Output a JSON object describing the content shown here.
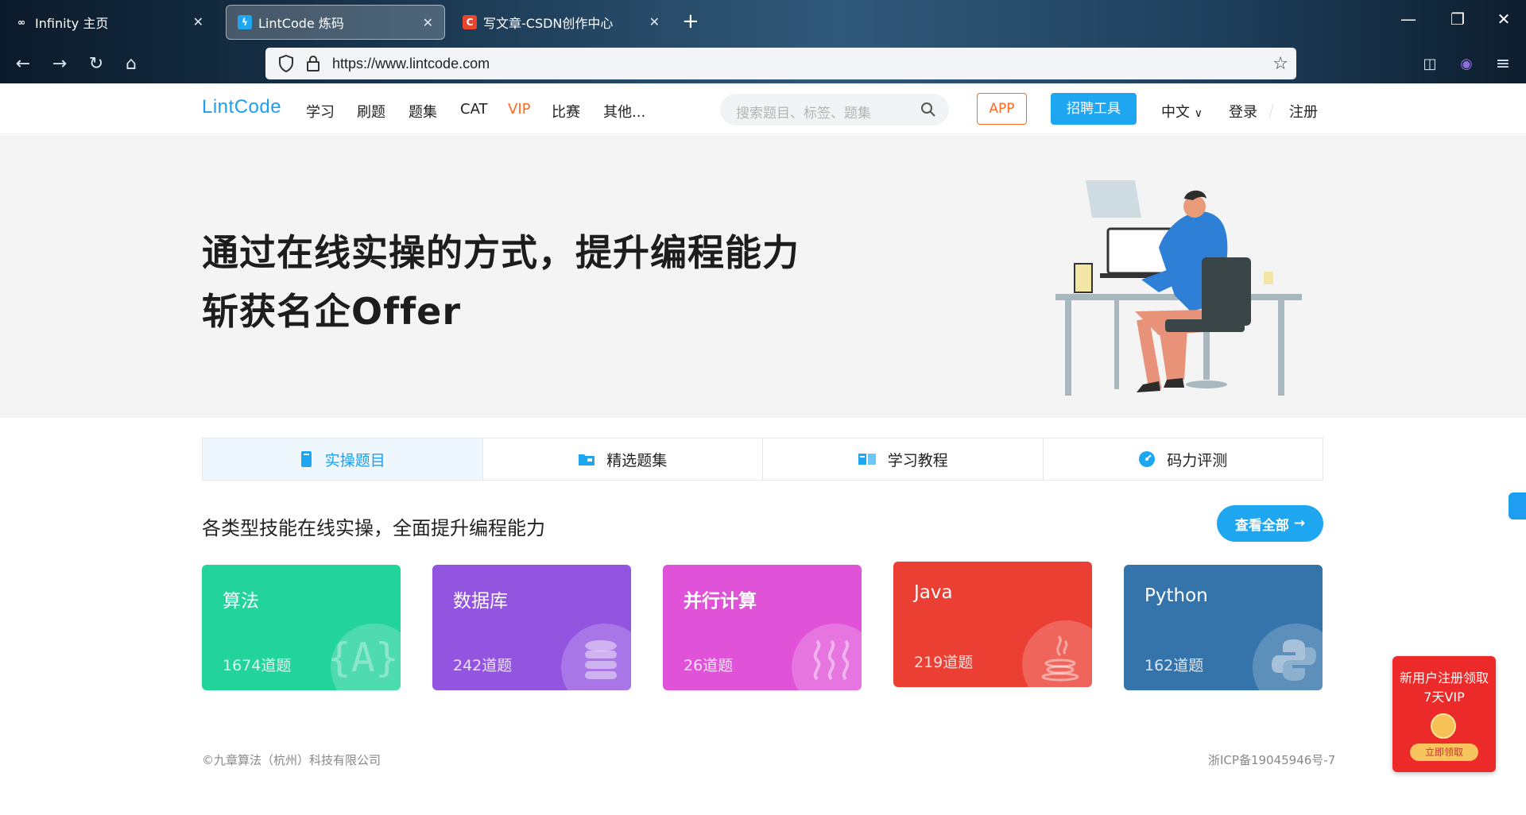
{
  "browser": {
    "tabs": [
      {
        "title": "Infinity 主页",
        "icon": "infinity-icon"
      },
      {
        "title": "LintCode 炼码",
        "icon": "lintcode-icon"
      },
      {
        "title": "写文章-CSDN创作中心",
        "icon": "csdn-icon"
      }
    ],
    "new_tab": "+",
    "url": "https://www.lintcode.com"
  },
  "header": {
    "logo": "LintCode",
    "nav": [
      "学习",
      "刷题",
      "题集",
      "CAT",
      "VIP",
      "比赛",
      "其他..."
    ],
    "search_placeholder": "搜索题目、标签、题集",
    "app_label": "APP",
    "hire_label": "招聘工具",
    "lang_label": "中文",
    "login_label": "登录",
    "register_label": "注册"
  },
  "hero": {
    "line1": "通过在线实操的方式，提升编程能力",
    "line2": "斩获名企Offer"
  },
  "tabs": [
    {
      "label": "实操题目",
      "active": true,
      "icon": "book-icon"
    },
    {
      "label": "精选题集",
      "active": false,
      "icon": "folder-icon"
    },
    {
      "label": "学习教程",
      "active": false,
      "icon": "open-book-icon"
    },
    {
      "label": "码力评测",
      "active": false,
      "icon": "gauge-icon"
    }
  ],
  "section": {
    "title": "各类型技能在线实操，全面提升编程能力",
    "view_all": "查看全部"
  },
  "cards": [
    {
      "title": "算法",
      "count": "1674道题",
      "color": "#22d39a",
      "icon": "algorithm-icon"
    },
    {
      "title": "数据库",
      "count": "242道题",
      "color": "#9354e0",
      "icon": "database-icon"
    },
    {
      "title": "并行计算",
      "count": "26道题",
      "color": "#e053d8",
      "icon": "parallel-icon"
    },
    {
      "title": "Java",
      "count": "219道题",
      "color": "#ec3f33",
      "icon": "java-icon"
    },
    {
      "title": "Python",
      "count": "162道题",
      "color": "#3574ab",
      "icon": "python-icon"
    }
  ],
  "footer": {
    "copyright": "©九章算法（杭州）科技有限公司",
    "icp": "浙ICP备19045946号-7"
  },
  "promo": {
    "line1": "新用户注册领取",
    "line2": "7天VIP",
    "button": "立即领取"
  },
  "colors": {
    "brand": "#1e9ef0",
    "vip": "#ff6a1e"
  }
}
